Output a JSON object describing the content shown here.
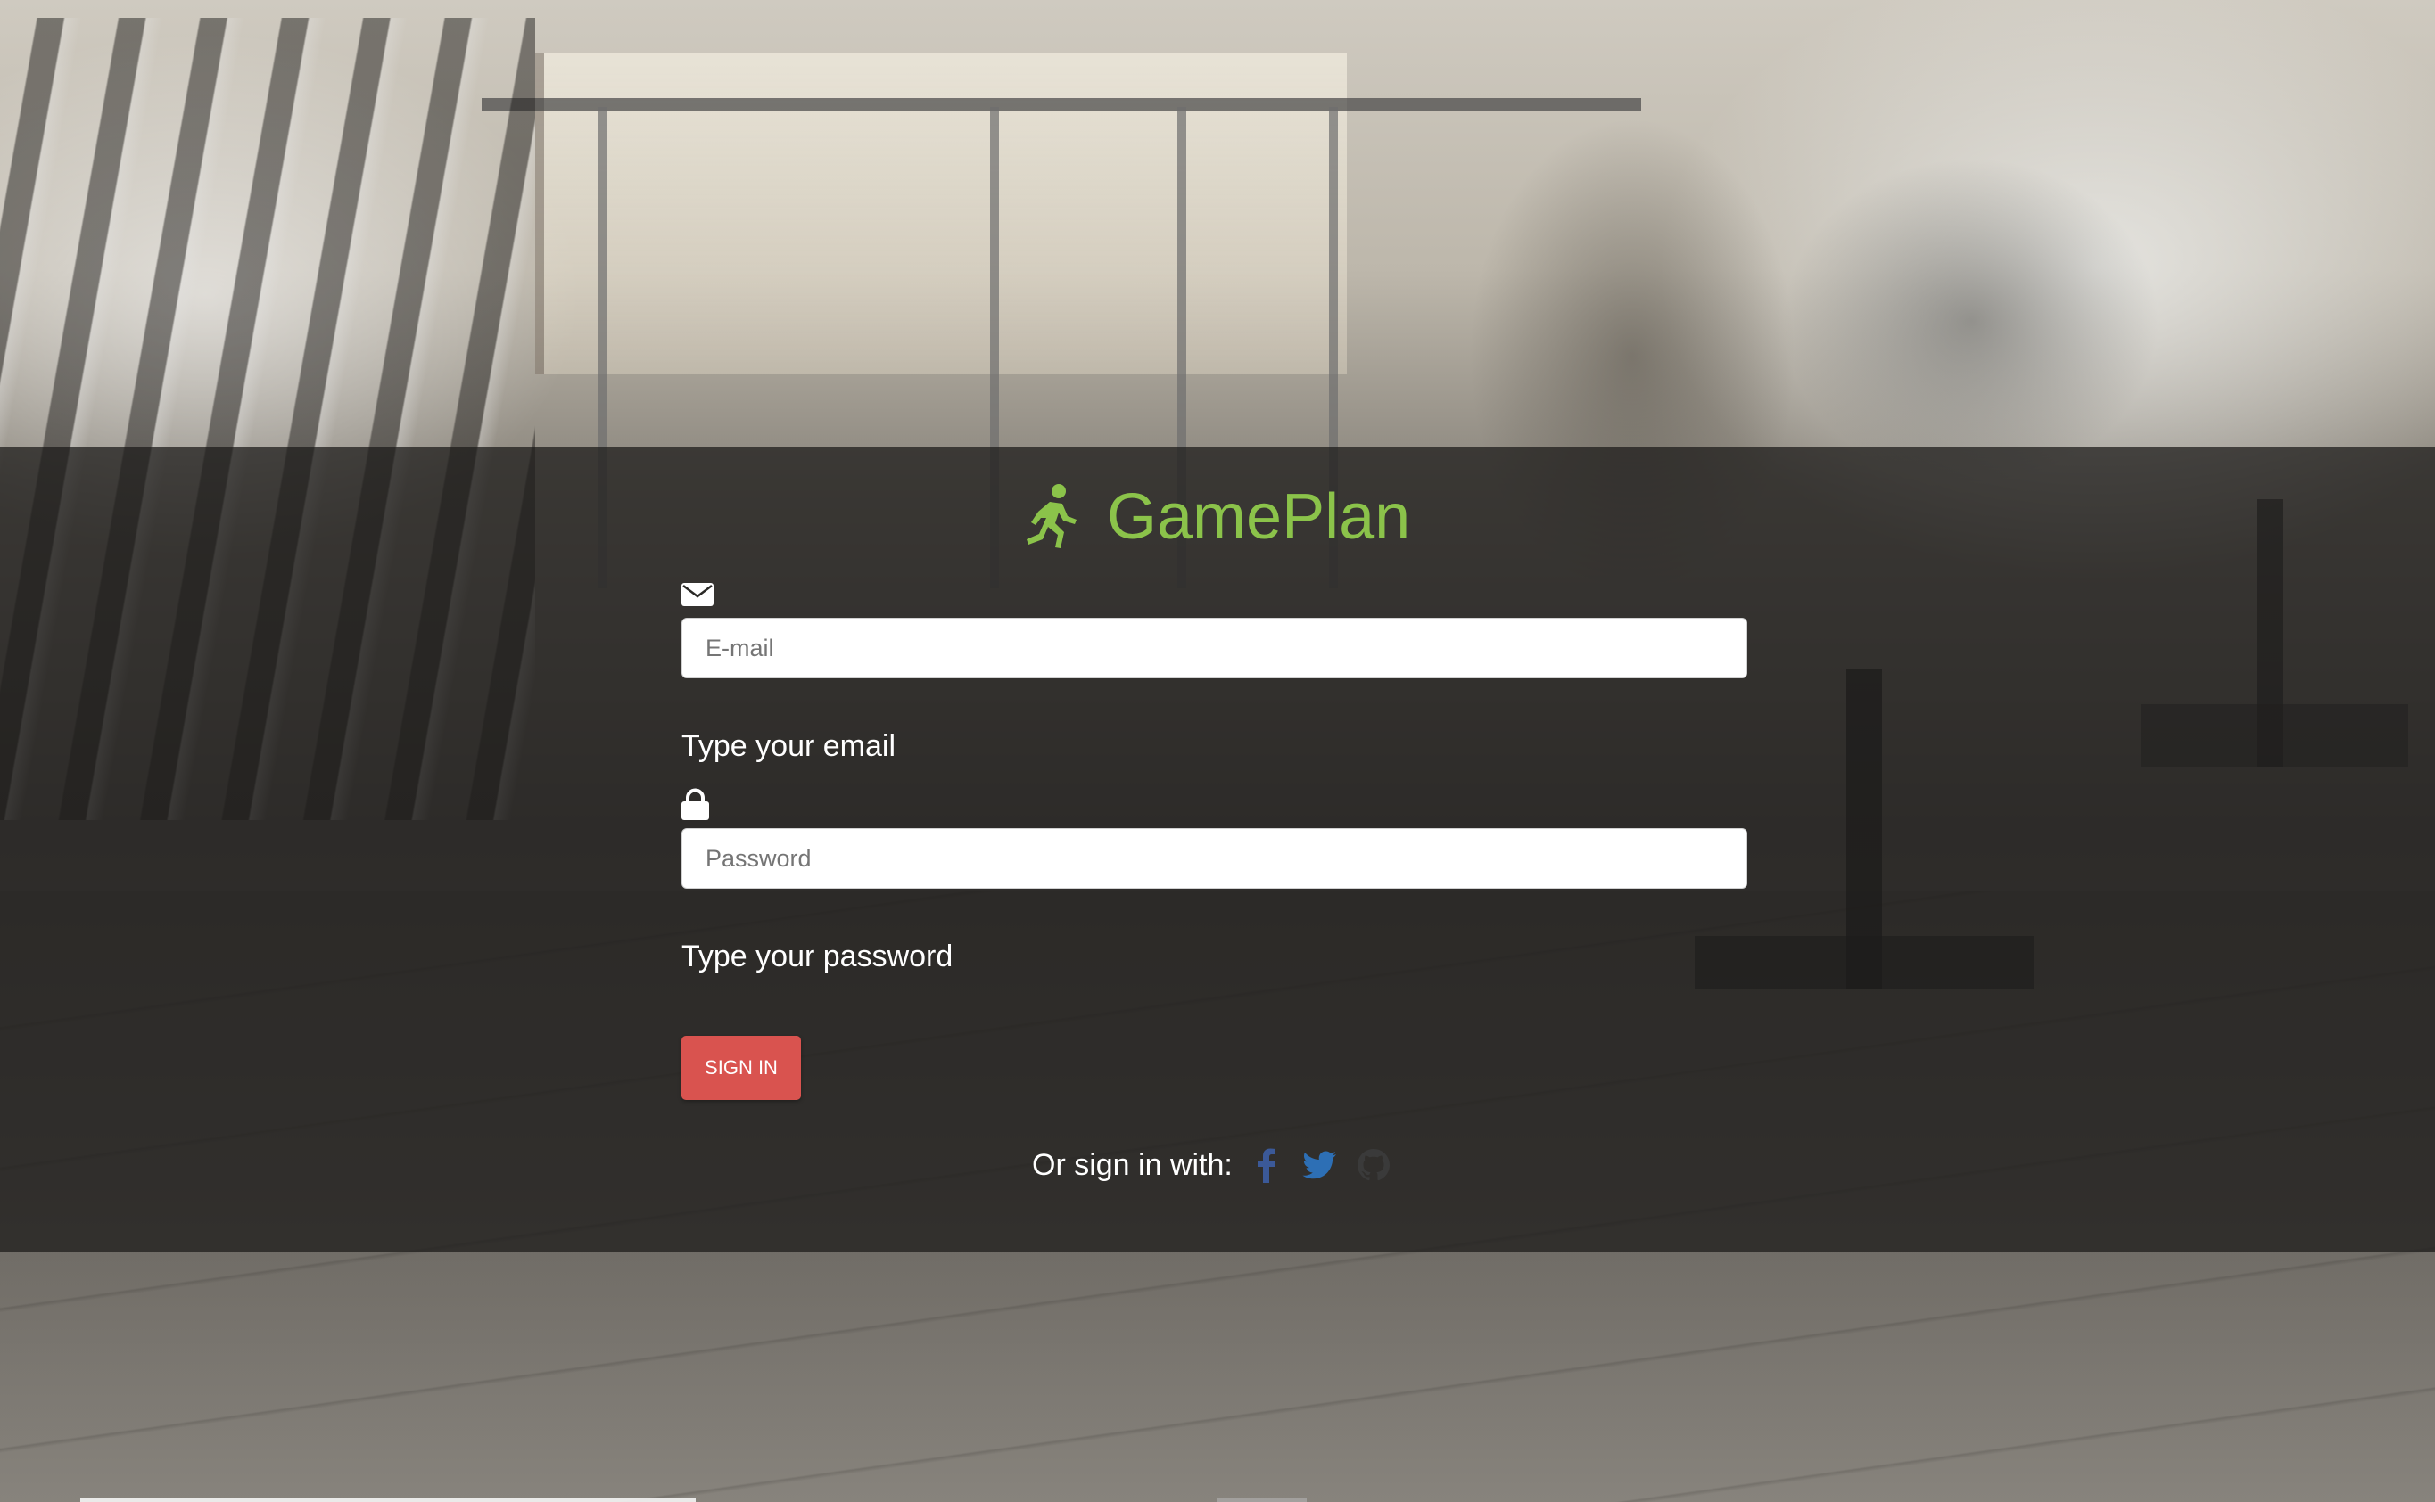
{
  "brand": {
    "name": "GamePlan",
    "icon": "running-person-icon",
    "color": "#8bc34a"
  },
  "login": {
    "email": {
      "icon": "envelope-icon",
      "placeholder": "E-mail",
      "value": "",
      "helper": "Type your email"
    },
    "password": {
      "icon": "lock-icon",
      "placeholder": "Password",
      "value": "",
      "helper": "Type your password"
    },
    "signin_label": "SIGN IN",
    "signin_color": "#d9534f"
  },
  "social": {
    "label": "Or sign in with:",
    "providers": [
      {
        "name": "facebook",
        "icon": "facebook-icon",
        "color": "#3b5998"
      },
      {
        "name": "twitter",
        "icon": "twitter-icon",
        "color": "#2d6fb5"
      },
      {
        "name": "github",
        "icon": "github-icon",
        "color": "#3a3a3a"
      }
    ]
  }
}
